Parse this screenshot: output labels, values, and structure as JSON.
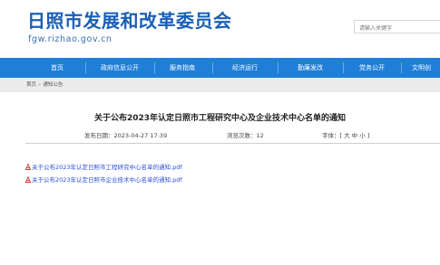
{
  "header": {
    "site_title": "日照市发展和改革委员会",
    "site_domain": "fgw.rizhao.gov.cn",
    "search_placeholder": "请输入关键字"
  },
  "nav": {
    "items": [
      {
        "label": "首页"
      },
      {
        "label": "政府信息公开"
      },
      {
        "label": "服务指南"
      },
      {
        "label": "经济运行"
      },
      {
        "label": "勤廉发改"
      },
      {
        "label": "党务公开"
      },
      {
        "label": "文明创"
      }
    ],
    "bg_color": "#1f7ed8"
  },
  "breadcrumb": {
    "home": "首页",
    "separator": "»",
    "current": "通知公告"
  },
  "article": {
    "title": "关于公布2023年认定日照市工程研究中心及企业技术中心名单的通知",
    "date": "发布日期：2023-04-27 17:39",
    "views": "浏览次数：12",
    "font_size_label": "字体：[ 大 中 小 ]",
    "attachments": [
      {
        "label": "关于公布2023年认定日照市工程研究中心名单的通知.pdf",
        "icon": "pdf-icon"
      },
      {
        "label": "关于公布2023年认定日照市企业技术中心名单的通知.pdf",
        "icon": "pdf-icon"
      }
    ]
  }
}
